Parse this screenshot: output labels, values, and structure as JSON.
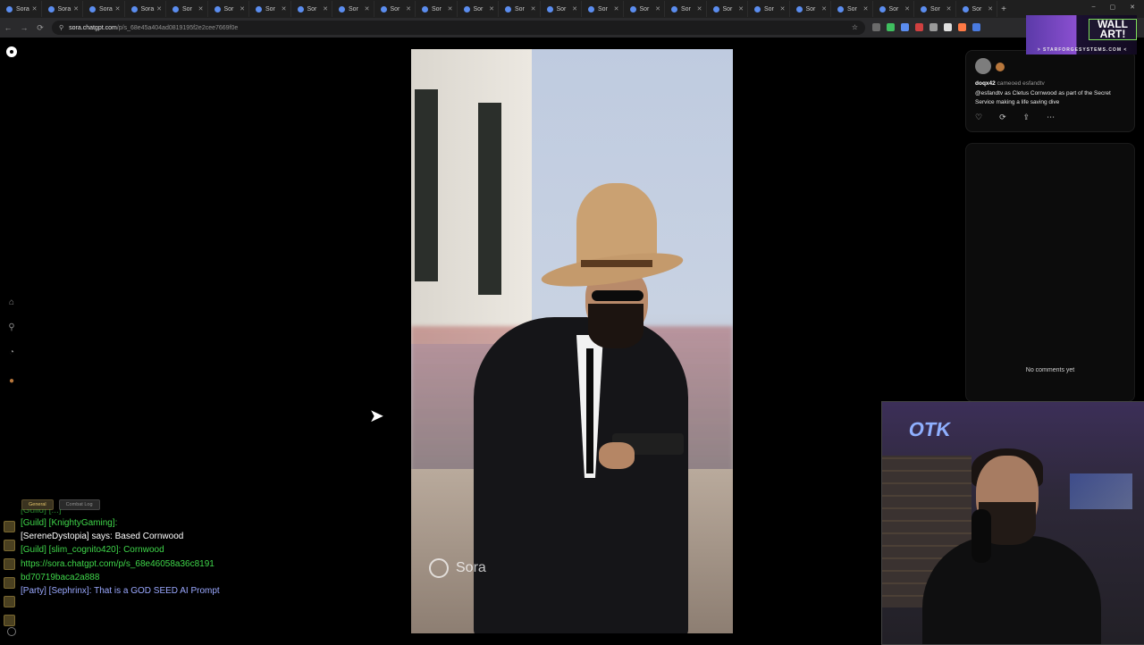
{
  "browser": {
    "tabs": [
      {
        "label": "Sora",
        "active": false
      },
      {
        "label": "Sora",
        "active": false
      },
      {
        "label": "Sora",
        "active": false
      },
      {
        "label": "Sora",
        "active": false
      },
      {
        "label": "Sor",
        "active": false
      },
      {
        "label": "Sor",
        "active": false
      },
      {
        "label": "Sor",
        "active": false
      },
      {
        "label": "Sor",
        "active": false
      },
      {
        "label": "Sor",
        "active": false
      },
      {
        "label": "Sor",
        "active": false
      },
      {
        "label": "Sor",
        "active": false
      },
      {
        "label": "Sor",
        "active": false
      },
      {
        "label": "Sor",
        "active": false
      },
      {
        "label": "Sor",
        "active": false
      },
      {
        "label": "Sor",
        "active": false
      },
      {
        "label": "Sor",
        "active": false
      },
      {
        "label": "Sor",
        "active": false
      },
      {
        "label": "Sor",
        "active": false
      },
      {
        "label": "Sor",
        "active": false
      },
      {
        "label": "Sor",
        "active": false
      },
      {
        "label": "Sor",
        "active": false
      },
      {
        "label": "Sor",
        "active": false
      },
      {
        "label": "Sor",
        "active": false
      },
      {
        "label": "Sor",
        "active": false
      }
    ],
    "new_tab_label": "+",
    "window_controls": [
      "–",
      "▢",
      "✕"
    ],
    "url_host": "sora.chatgpt.com",
    "url_path": "/p/s_68e45a404ad0819195f2e2cee7669f0e",
    "extension_colors": [
      "#6b6b6b",
      "#3fbf5f",
      "#5b8def",
      "#d04040",
      "#9a9a9a",
      "#e0e0e0",
      "#ff7a45",
      "#4a7be0"
    ]
  },
  "video": {
    "watermark": "Sora"
  },
  "post": {
    "username": "doqx42",
    "cameo_text": "cameoed esfandtv",
    "caption": "@esfandtv as Cletus Cornwood as part of the Secret Service making a life saving dive",
    "actions": [
      "like-icon",
      "remix-icon",
      "share-icon",
      "more-icon"
    ],
    "action_glyphs": [
      "♡",
      "⟳",
      "⇪",
      "⋯"
    ]
  },
  "comments": {
    "empty_text": "No comments yet"
  },
  "ad": {
    "title": "WALL ART!",
    "subtitle": "> STARFORGESYSTEMS.COM <"
  },
  "chat": {
    "tabs": [
      "General",
      "Combat Log"
    ],
    "lines": [
      {
        "prefix": "[Guild] [KnightyGaming]:",
        "text": " ",
        "kind": "guild"
      },
      {
        "prefix": "[SereneDystopia] says:",
        "text": " Based Cornwood",
        "kind": "say"
      },
      {
        "prefix": "[Guild] [slim_cognito420]:",
        "text": " Cornwood",
        "kind": "guild"
      },
      {
        "prefix": "https://sora.chatgpt.com/p/s_68e46058a36c8191",
        "text": "",
        "kind": "link"
      },
      {
        "prefix": "bd70719baca2a888",
        "text": "",
        "kind": "link"
      },
      {
        "prefix": "[Party] [Sephrinx]:",
        "text": " That is a GOD SEED AI Prompt",
        "kind": "party"
      }
    ]
  },
  "webcam": {
    "logo": "OTK"
  }
}
